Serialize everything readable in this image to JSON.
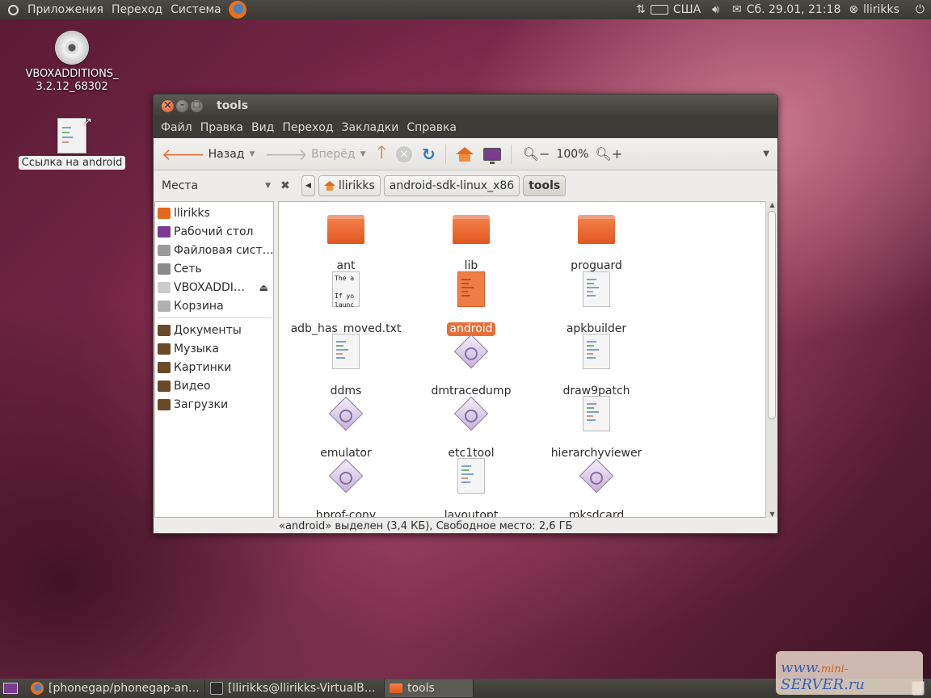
{
  "top_panel": {
    "menus": [
      "Приложения",
      "Переход",
      "Система"
    ],
    "keyboard_layout": "США",
    "datetime": "Сб. 29.01, 21:18",
    "user": "llirikks"
  },
  "desktop": {
    "icons": [
      {
        "label_line1": "VBOXADDITIONS_",
        "label_line2": "3.2.12_68302",
        "icon": "cd-icon"
      },
      {
        "label": "Ссылка на android",
        "icon": "text-file-link-icon",
        "selected": true
      }
    ]
  },
  "window": {
    "title": "tools",
    "menu": [
      "Файл",
      "Правка",
      "Вид",
      "Переход",
      "Закладки",
      "Справка"
    ],
    "toolbar": {
      "back_label": "Назад",
      "forward_label": "Вперёд",
      "zoom": "100%"
    },
    "places_label": "Места",
    "breadcrumbs": [
      "llirikks",
      "android-sdk-linux_x86",
      "tools"
    ],
    "sidebar": {
      "group1": [
        {
          "label": "llirikks",
          "icon": "home-icon",
          "color": "#e26a1e"
        },
        {
          "label": "Рабочий стол",
          "icon": "desktop-icon",
          "color": "#7b3b8f"
        },
        {
          "label": "Файловая сист…",
          "icon": "drive-icon",
          "color": "#9a9a9a"
        },
        {
          "label": "Сеть",
          "icon": "network-icon",
          "color": "#8a8a8a"
        },
        {
          "label": "VBOXADDI…",
          "icon": "cd-icon",
          "color": "#cccccc"
        },
        {
          "label": "Корзина",
          "icon": "trash-icon",
          "color": "#b0b0b0"
        }
      ],
      "group2": [
        {
          "label": "Документы",
          "icon": "documents-folder-icon",
          "color": "#6b4a2a"
        },
        {
          "label": "Музыка",
          "icon": "music-folder-icon",
          "color": "#6b4a2a"
        },
        {
          "label": "Картинки",
          "icon": "pictures-folder-icon",
          "color": "#6b4a2a"
        },
        {
          "label": "Видео",
          "icon": "videos-folder-icon",
          "color": "#6b4a2a"
        },
        {
          "label": "Загрузки",
          "icon": "downloads-folder-icon",
          "color": "#6b4a2a"
        }
      ]
    },
    "files": [
      {
        "name": "ant",
        "type": "folder"
      },
      {
        "name": "lib",
        "type": "folder"
      },
      {
        "name": "proguard",
        "type": "folder"
      },
      {
        "name": "adb_has_moved.txt",
        "type": "text",
        "preview": [
          "The a",
          "",
          "If yo",
          "launc"
        ]
      },
      {
        "name": "android",
        "type": "script",
        "selected": true
      },
      {
        "name": "apkbuilder",
        "type": "script"
      },
      {
        "name": "ddms",
        "type": "script"
      },
      {
        "name": "dmtracedump",
        "type": "exe"
      },
      {
        "name": "draw9patch",
        "type": "script"
      },
      {
        "name": "emulator",
        "type": "exe"
      },
      {
        "name": "etc1tool",
        "type": "exe"
      },
      {
        "name": "hierarchyviewer",
        "type": "script"
      },
      {
        "name": "hprof-conv",
        "type": "exe"
      },
      {
        "name": "layoutopt",
        "type": "script"
      },
      {
        "name": "mksdcard",
        "type": "exe"
      }
    ],
    "status": "«android» выделен (3,4 КБ), Свободное место: 2,6 ГБ"
  },
  "taskbar": {
    "tasks": [
      {
        "label": "[phonegap/phonegap-an…",
        "icon": "firefox-icon"
      },
      {
        "label": "[llirikks@llirikks-VirtualB…",
        "icon": "terminal-icon"
      },
      {
        "label": "tools",
        "icon": "folder-icon",
        "active": true
      }
    ]
  },
  "watermark": {
    "left": "www.",
    "mid": "mini-",
    "right": "SERVER.ru"
  },
  "colors": {
    "accent": "#e96e38",
    "panel": "#3c3b37"
  }
}
